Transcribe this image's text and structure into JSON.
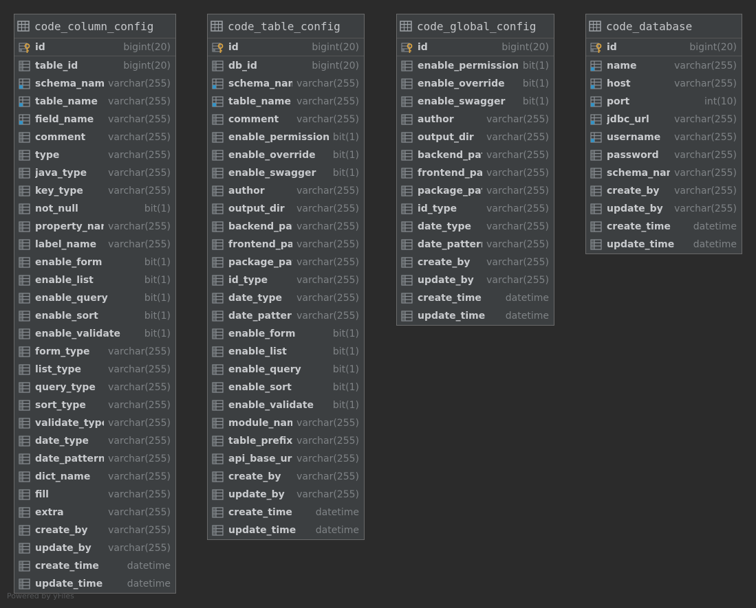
{
  "tables": [
    {
      "name": "code_column_config",
      "columns": [
        {
          "name": "id",
          "type": "bigint(20)",
          "kind": "pk"
        },
        {
          "name": "table_id",
          "type": "bigint(20)",
          "kind": "col"
        },
        {
          "name": "schema_name",
          "type": "varchar(255)",
          "kind": "idx"
        },
        {
          "name": "table_name",
          "type": "varchar(255)",
          "kind": "idx"
        },
        {
          "name": "field_name",
          "type": "varchar(255)",
          "kind": "idx"
        },
        {
          "name": "comment",
          "type": "varchar(255)",
          "kind": "col"
        },
        {
          "name": "type",
          "type": "varchar(255)",
          "kind": "col"
        },
        {
          "name": "java_type",
          "type": "varchar(255)",
          "kind": "col"
        },
        {
          "name": "key_type",
          "type": "varchar(255)",
          "kind": "col"
        },
        {
          "name": "not_null",
          "type": "bit(1)",
          "kind": "col"
        },
        {
          "name": "property_name",
          "type": "varchar(255)",
          "kind": "col"
        },
        {
          "name": "label_name",
          "type": "varchar(255)",
          "kind": "col"
        },
        {
          "name": "enable_form",
          "type": "bit(1)",
          "kind": "col"
        },
        {
          "name": "enable_list",
          "type": "bit(1)",
          "kind": "col"
        },
        {
          "name": "enable_query",
          "type": "bit(1)",
          "kind": "col"
        },
        {
          "name": "enable_sort",
          "type": "bit(1)",
          "kind": "col"
        },
        {
          "name": "enable_validate",
          "type": "bit(1)",
          "kind": "col"
        },
        {
          "name": "form_type",
          "type": "varchar(255)",
          "kind": "col"
        },
        {
          "name": "list_type",
          "type": "varchar(255)",
          "kind": "col"
        },
        {
          "name": "query_type",
          "type": "varchar(255)",
          "kind": "col"
        },
        {
          "name": "sort_type",
          "type": "varchar(255)",
          "kind": "col"
        },
        {
          "name": "validate_type",
          "type": "varchar(255)",
          "kind": "col"
        },
        {
          "name": "date_type",
          "type": "varchar(255)",
          "kind": "col"
        },
        {
          "name": "date_pattern",
          "type": "varchar(255)",
          "kind": "col"
        },
        {
          "name": "dict_name",
          "type": "varchar(255)",
          "kind": "col"
        },
        {
          "name": "fill",
          "type": "varchar(255)",
          "kind": "col"
        },
        {
          "name": "extra",
          "type": "varchar(255)",
          "kind": "col"
        },
        {
          "name": "create_by",
          "type": "varchar(255)",
          "kind": "col"
        },
        {
          "name": "update_by",
          "type": "varchar(255)",
          "kind": "col"
        },
        {
          "name": "create_time",
          "type": "datetime",
          "kind": "col"
        },
        {
          "name": "update_time",
          "type": "datetime",
          "kind": "col"
        }
      ]
    },
    {
      "name": "code_table_config",
      "columns": [
        {
          "name": "id",
          "type": "bigint(20)",
          "kind": "pk"
        },
        {
          "name": "db_id",
          "type": "bigint(20)",
          "kind": "col"
        },
        {
          "name": "schema_name",
          "type": "varchar(255)",
          "kind": "idx"
        },
        {
          "name": "table_name",
          "type": "varchar(255)",
          "kind": "idx"
        },
        {
          "name": "comment",
          "type": "varchar(255)",
          "kind": "col"
        },
        {
          "name": "enable_permission",
          "type": "bit(1)",
          "kind": "col"
        },
        {
          "name": "enable_override",
          "type": "bit(1)",
          "kind": "col"
        },
        {
          "name": "enable_swagger",
          "type": "bit(1)",
          "kind": "col"
        },
        {
          "name": "author",
          "type": "varchar(255)",
          "kind": "col"
        },
        {
          "name": "output_dir",
          "type": "varchar(255)",
          "kind": "col"
        },
        {
          "name": "backend_path",
          "type": "varchar(255)",
          "kind": "col"
        },
        {
          "name": "frontend_path",
          "type": "varchar(255)",
          "kind": "col"
        },
        {
          "name": "package_path",
          "type": "varchar(255)",
          "kind": "col"
        },
        {
          "name": "id_type",
          "type": "varchar(255)",
          "kind": "col"
        },
        {
          "name": "date_type",
          "type": "varchar(255)",
          "kind": "col"
        },
        {
          "name": "date_pattern",
          "type": "varchar(255)",
          "kind": "col"
        },
        {
          "name": "enable_form",
          "type": "bit(1)",
          "kind": "col"
        },
        {
          "name": "enable_list",
          "type": "bit(1)",
          "kind": "col"
        },
        {
          "name": "enable_query",
          "type": "bit(1)",
          "kind": "col"
        },
        {
          "name": "enable_sort",
          "type": "bit(1)",
          "kind": "col"
        },
        {
          "name": "enable_validate",
          "type": "bit(1)",
          "kind": "col"
        },
        {
          "name": "module_name",
          "type": "varchar(255)",
          "kind": "col"
        },
        {
          "name": "table_prefix",
          "type": "varchar(255)",
          "kind": "col"
        },
        {
          "name": "api_base_url",
          "type": "varchar(255)",
          "kind": "col"
        },
        {
          "name": "create_by",
          "type": "varchar(255)",
          "kind": "col"
        },
        {
          "name": "update_by",
          "type": "varchar(255)",
          "kind": "col"
        },
        {
          "name": "create_time",
          "type": "datetime",
          "kind": "col"
        },
        {
          "name": "update_time",
          "type": "datetime",
          "kind": "col"
        }
      ]
    },
    {
      "name": "code_global_config",
      "columns": [
        {
          "name": "id",
          "type": "bigint(20)",
          "kind": "pk"
        },
        {
          "name": "enable_permission",
          "type": "bit(1)",
          "kind": "col"
        },
        {
          "name": "enable_override",
          "type": "bit(1)",
          "kind": "col"
        },
        {
          "name": "enable_swagger",
          "type": "bit(1)",
          "kind": "col"
        },
        {
          "name": "author",
          "type": "varchar(255)",
          "kind": "col"
        },
        {
          "name": "output_dir",
          "type": "varchar(255)",
          "kind": "col"
        },
        {
          "name": "backend_path",
          "type": "varchar(255)",
          "kind": "col"
        },
        {
          "name": "frontend_path",
          "type": "varchar(255)",
          "kind": "col"
        },
        {
          "name": "package_path",
          "type": "varchar(255)",
          "kind": "col"
        },
        {
          "name": "id_type",
          "type": "varchar(255)",
          "kind": "col"
        },
        {
          "name": "date_type",
          "type": "varchar(255)",
          "kind": "col"
        },
        {
          "name": "date_pattern",
          "type": "varchar(255)",
          "kind": "col"
        },
        {
          "name": "create_by",
          "type": "varchar(255)",
          "kind": "col"
        },
        {
          "name": "update_by",
          "type": "varchar(255)",
          "kind": "col"
        },
        {
          "name": "create_time",
          "type": "datetime",
          "kind": "col"
        },
        {
          "name": "update_time",
          "type": "datetime",
          "kind": "col"
        }
      ]
    },
    {
      "name": "code_database",
      "columns": [
        {
          "name": "id",
          "type": "bigint(20)",
          "kind": "pk"
        },
        {
          "name": "name",
          "type": "varchar(255)",
          "kind": "idx"
        },
        {
          "name": "host",
          "type": "varchar(255)",
          "kind": "idx"
        },
        {
          "name": "port",
          "type": "int(10)",
          "kind": "idx"
        },
        {
          "name": "jdbc_url",
          "type": "varchar(255)",
          "kind": "idx"
        },
        {
          "name": "username",
          "type": "varchar(255)",
          "kind": "idx"
        },
        {
          "name": "password",
          "type": "varchar(255)",
          "kind": "col"
        },
        {
          "name": "schema_name",
          "type": "varchar(255)",
          "kind": "col"
        },
        {
          "name": "create_by",
          "type": "varchar(255)",
          "kind": "col"
        },
        {
          "name": "update_by",
          "type": "varchar(255)",
          "kind": "col"
        },
        {
          "name": "create_time",
          "type": "datetime",
          "kind": "col"
        },
        {
          "name": "update_time",
          "type": "datetime",
          "kind": "col"
        }
      ]
    }
  ],
  "icons": {
    "table": "table-icon",
    "primary_key": "primary-key-icon",
    "indexed_column": "indexed-column-icon",
    "column": "column-icon"
  },
  "colors": {
    "background": "#2b2b2b",
    "table_fill": "#3c3f41",
    "key": "#d9a343",
    "index_marker": "#3592c4"
  },
  "watermark": "Powered by yFiles"
}
